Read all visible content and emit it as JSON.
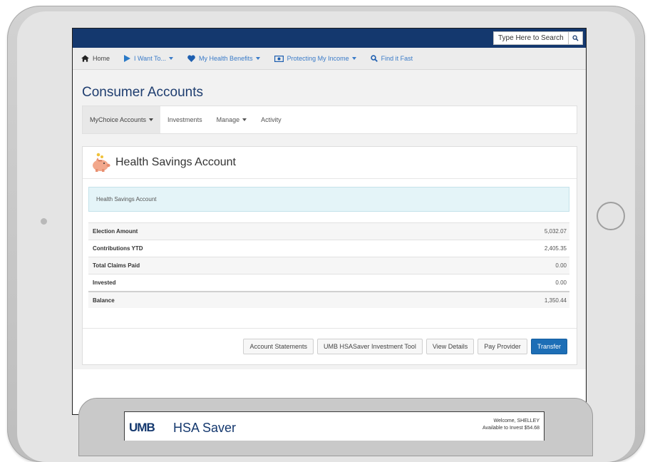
{
  "header": {
    "search_placeholder": "Type Here to Search",
    "search_icon": "search-icon"
  },
  "nav": {
    "items": [
      {
        "label": "Home",
        "icon": "home-icon"
      },
      {
        "label": "I Want To...",
        "icon": "play-icon"
      },
      {
        "label": "My Health Benefits",
        "icon": "heart-icon"
      },
      {
        "label": "Protecting My Income",
        "icon": "money-icon"
      },
      {
        "label": "Find it Fast",
        "icon": "search-icon"
      }
    ]
  },
  "page": {
    "title": "Consumer Accounts"
  },
  "subnav": {
    "items": [
      {
        "label": "MyChoice Accounts"
      },
      {
        "label": "Investments"
      },
      {
        "label": "Manage"
      },
      {
        "label": "Activity"
      }
    ]
  },
  "panel": {
    "title": "Health Savings Account",
    "icon": "piggy-bank-icon",
    "info_text": "Health Savings Account",
    "rows": [
      {
        "label": "Election Amount",
        "value": "5,032.07"
      },
      {
        "label": "Contributions YTD",
        "value": "2,405.35"
      },
      {
        "label": "Total Claims Paid",
        "value": "0.00"
      },
      {
        "label": "Invested",
        "value": "0.00"
      },
      {
        "label": "Balance",
        "value": "1,350.44"
      }
    ],
    "buttons": [
      {
        "label": "Account Statements"
      },
      {
        "label": "UMB HSASaver Investment Tool"
      },
      {
        "label": "View Details"
      },
      {
        "label": "Pay Provider"
      },
      {
        "label": "Transfer"
      }
    ]
  },
  "second_device": {
    "logo": "UMB",
    "product": "HSA Saver",
    "welcome": "Welcome, SHELLEY",
    "available": "Available to Invest $54.68"
  },
  "colors": {
    "navy": "#14386e",
    "link_blue": "#3a7bc8",
    "primary_button": "#1d6eb6",
    "info_bg": "#e4f4f8"
  }
}
